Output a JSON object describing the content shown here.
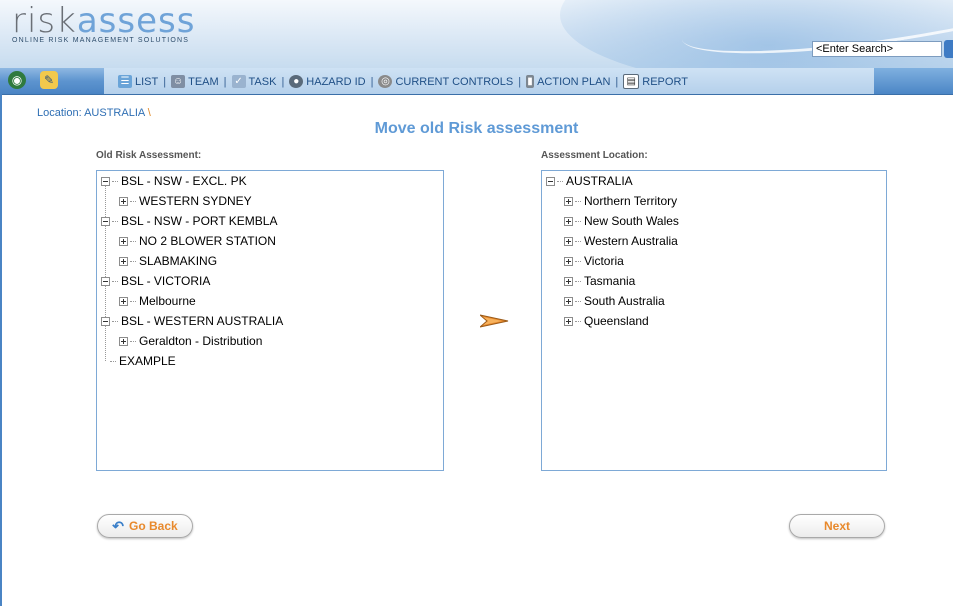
{
  "header": {
    "logo_risk": "risk",
    "logo_assess": "assess",
    "logo_tagline": "ONLINE RISK MANAGEMENT SOLUTIONS",
    "search_value": "<Enter Search>"
  },
  "nav": {
    "items": [
      {
        "label": "LIST",
        "icon": "list-icon"
      },
      {
        "label": "TEAM",
        "icon": "team-icon"
      },
      {
        "label": "TASK",
        "icon": "task-icon"
      },
      {
        "label": "HAZARD ID",
        "icon": "hazard-icon"
      },
      {
        "label": "CURRENT CONTROLS",
        "icon": "controls-icon"
      },
      {
        "label": "ACTION PLAN",
        "icon": "action-plan-icon"
      },
      {
        "label": "REPORT",
        "icon": "report-icon"
      }
    ],
    "separator": "|"
  },
  "breadcrumb": {
    "text": "Location: AUSTRALIA",
    "slash": "\\"
  },
  "page_title": "Move old Risk assessment",
  "left_panel": {
    "label": "Old Risk Assessment:",
    "nodes": [
      {
        "label": "BSL - NSW - EXCL. PK",
        "level": 0,
        "expander": "minus"
      },
      {
        "label": "WESTERN SYDNEY",
        "level": 1,
        "expander": "plus"
      },
      {
        "label": "BSL - NSW - PORT KEMBLA",
        "level": 0,
        "expander": "minus"
      },
      {
        "label": "NO 2 BLOWER STATION",
        "level": 1,
        "expander": "plus"
      },
      {
        "label": "SLABMAKING",
        "level": 1,
        "expander": "plus"
      },
      {
        "label": "BSL - VICTORIA",
        "level": 0,
        "expander": "minus"
      },
      {
        "label": "Melbourne",
        "level": 1,
        "expander": "plus"
      },
      {
        "label": "BSL - WESTERN AUSTRALIA",
        "level": 0,
        "expander": "minus"
      },
      {
        "label": "Geraldton - Distribution",
        "level": 1,
        "expander": "plus"
      },
      {
        "label": "EXAMPLE",
        "level": 0,
        "expander": "none"
      }
    ]
  },
  "right_panel": {
    "label": "Assessment Location:",
    "nodes": [
      {
        "label": "AUSTRALIA",
        "level": 0,
        "expander": "minus"
      },
      {
        "label": "Northern Territory",
        "level": 1,
        "expander": "plus"
      },
      {
        "label": "New South Wales",
        "level": 1,
        "expander": "plus"
      },
      {
        "label": "Western Australia",
        "level": 1,
        "expander": "plus"
      },
      {
        "label": "Victoria",
        "level": 1,
        "expander": "plus"
      },
      {
        "label": "Tasmania",
        "level": 1,
        "expander": "plus"
      },
      {
        "label": "South Australia",
        "level": 1,
        "expander": "plus"
      },
      {
        "label": "Queensland",
        "level": 1,
        "expander": "plus"
      }
    ]
  },
  "buttons": {
    "go_back": "Go Back",
    "next": "Next"
  },
  "colors": {
    "accent": "#5f9ad6",
    "button_text": "#e8892c",
    "nav_bar": "#4a84c4"
  }
}
